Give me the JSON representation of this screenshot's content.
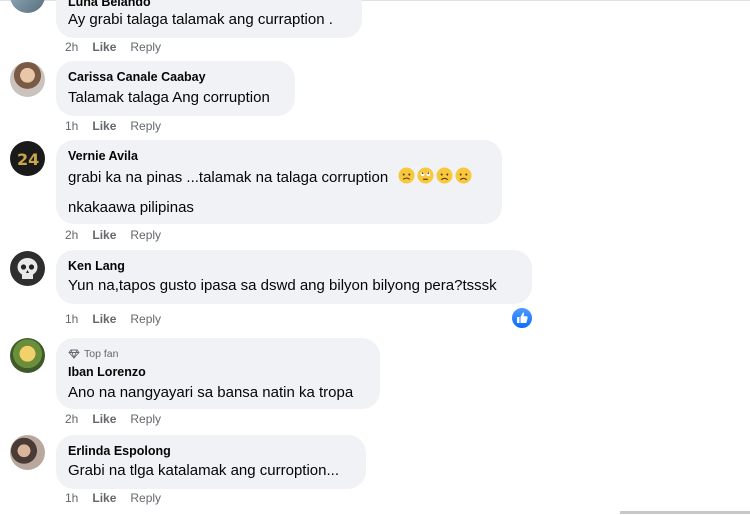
{
  "colors": {
    "bubble": "#f0f2f5",
    "text": "#050505",
    "secondary": "#65676b",
    "like_blue": "#0a6cff"
  },
  "comments": [
    {
      "name": "Luna Belando",
      "text": "Ay grabi talaga talamak ang curraption .",
      "time": "2h",
      "like": "Like",
      "reply": "Reply",
      "avatar_icon": "profile-photo"
    },
    {
      "name": "Carissa Canale Caabay",
      "text": "Talamak talaga Ang corruption",
      "time": "1h",
      "like": "Like",
      "reply": "Reply",
      "avatar_icon": "profile-photo"
    },
    {
      "name": "Vernie Avila",
      "text": "grabi ka na pinas ...talamak na talaga corruption",
      "emojis": [
        "worried-face-icon",
        "rolling-eyes-face-icon",
        "frowning-face-icon",
        "frowning-face-icon"
      ],
      "text2": "nkakaawa pilipinas",
      "time": "2h",
      "like": "Like",
      "reply": "Reply",
      "avatar_icon": "24-logo-photo"
    },
    {
      "name": "Ken Lang",
      "text": "Yun na,tapos gusto ipasa sa dswd ang bilyon bilyong pera?tsssk",
      "time": "1h",
      "like": "Like",
      "reply": "Reply",
      "reaction_icon": "like-reaction-icon",
      "avatar_icon": "skull-photo"
    },
    {
      "badge": "Top fan",
      "name": "Iban Lorenzo",
      "text": "Ano na nangyayari sa bansa natin ka tropa",
      "time": "2h",
      "like": "Like",
      "reply": "Reply",
      "avatar_icon": "profile-photo"
    },
    {
      "name": "Erlinda Espolong",
      "text": "Grabi na tlga katalamak ang curroption...",
      "time": "1h",
      "like": "Like",
      "reply": "Reply",
      "avatar_icon": "profile-photo"
    }
  ]
}
